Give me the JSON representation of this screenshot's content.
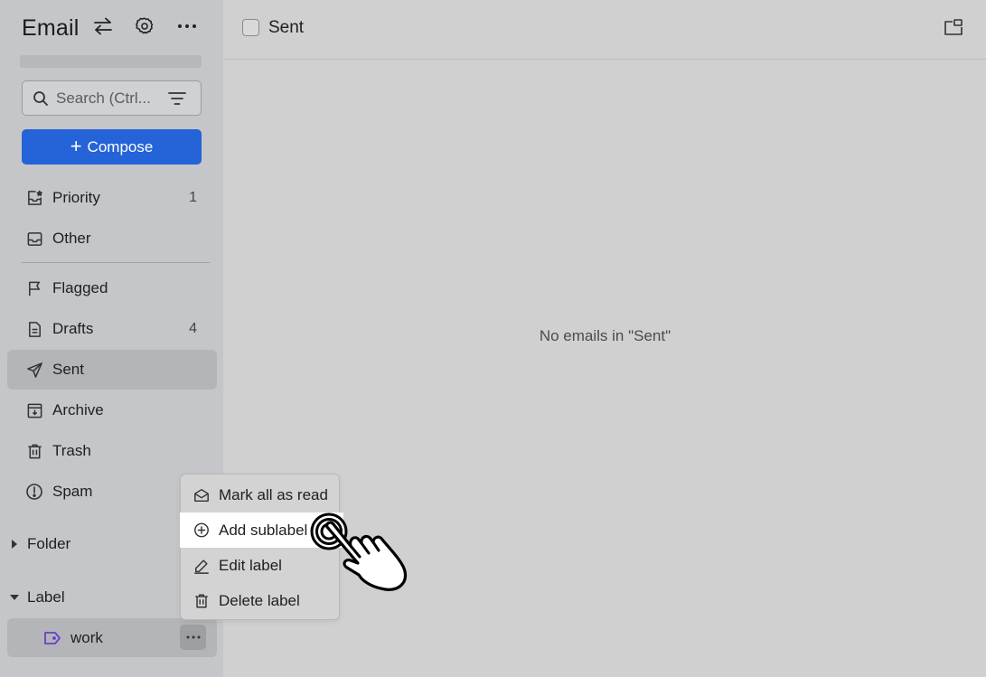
{
  "sidebar": {
    "title": "Email",
    "search_placeholder": "Search (Ctrl...",
    "compose_label": "Compose",
    "items": [
      {
        "label": "Priority",
        "count": "1",
        "icon": "inbox-star-icon"
      },
      {
        "label": "Other",
        "count": "",
        "icon": "inbox-icon"
      },
      {
        "label": "Flagged",
        "count": "",
        "icon": "flag-icon"
      },
      {
        "label": "Drafts",
        "count": "4",
        "icon": "draft-document-icon"
      },
      {
        "label": "Sent",
        "count": "",
        "icon": "send-icon",
        "active": true
      },
      {
        "label": "Archive",
        "count": "",
        "icon": "archive-icon"
      },
      {
        "label": "Trash",
        "count": "",
        "icon": "trash-icon"
      },
      {
        "label": "Spam",
        "count": "",
        "icon": "spam-icon"
      }
    ],
    "sections": {
      "folder": "Folder",
      "label": "Label"
    },
    "labels": [
      {
        "label": "work",
        "color": "#6a3fc8"
      }
    ]
  },
  "main": {
    "folder_title": "Sent",
    "empty_message": "No emails in \"Sent\""
  },
  "context_menu": {
    "items": [
      {
        "label": "Mark all as read",
        "icon": "envelope-open-icon"
      },
      {
        "label": "Add sublabel",
        "icon": "plus-circle-icon",
        "highlighted": true
      },
      {
        "label": "Edit label",
        "icon": "pencil-icon"
      },
      {
        "label": "Delete label",
        "icon": "trash-icon"
      }
    ]
  },
  "colors": {
    "accent": "#2563d8",
    "sidebar_bg": "#c4c6c9",
    "main_bg": "#d0d0d0",
    "label_tag": "#6a3fc8"
  }
}
